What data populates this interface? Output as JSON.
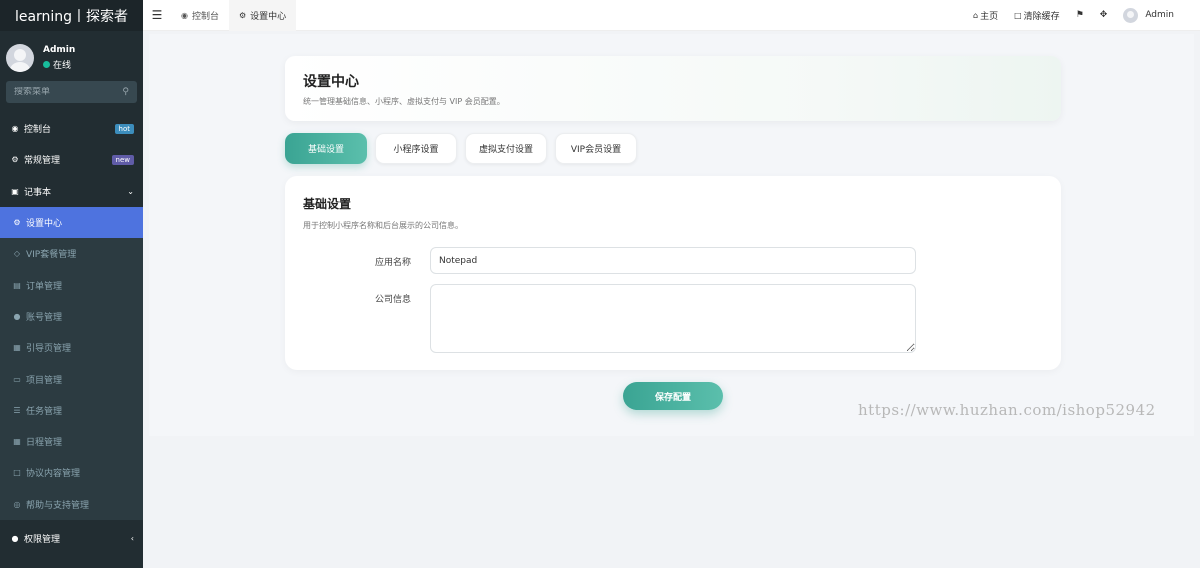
{
  "sidebar": {
    "logo": "learning丨探索者",
    "user": {
      "name": "Admin",
      "status": "在线"
    },
    "search_placeholder": "搜索菜单",
    "items": [
      {
        "label": "控制台",
        "badge": "hot",
        "icon": "dashboard-icon"
      },
      {
        "label": "常规管理",
        "badge": "new",
        "icon": "cogs-icon"
      },
      {
        "label": "记事本",
        "icon": "book-icon",
        "caret": "⌄"
      }
    ],
    "sub_items": [
      {
        "label": "设置中心",
        "active": true,
        "icon": "gear-icon"
      },
      {
        "label": "VIP套餐管理",
        "icon": "diamond-icon"
      },
      {
        "label": "订单管理",
        "icon": "list-icon"
      },
      {
        "label": "账号管理",
        "icon": "users-icon"
      },
      {
        "label": "引导页管理",
        "icon": "image-icon"
      },
      {
        "label": "项目管理",
        "icon": "folder-icon"
      },
      {
        "label": "任务管理",
        "icon": "tasks-icon"
      },
      {
        "label": "日程管理",
        "icon": "calendar-icon"
      },
      {
        "label": "协议内容管理",
        "icon": "file-icon"
      },
      {
        "label": "帮助与支持管理",
        "icon": "lifebuoy-icon"
      }
    ],
    "bottom_items": [
      {
        "label": "权限管理",
        "icon": "users-icon",
        "caret": "‹"
      }
    ]
  },
  "topbar": {
    "tabs": [
      {
        "label": "控制台",
        "icon": "dashboard-icon"
      },
      {
        "label": "设置中心",
        "icon": "gear-icon",
        "active": true
      }
    ],
    "links": {
      "home": "主页",
      "clear_cache": "清除缓存",
      "admin": "Admin"
    }
  },
  "header": {
    "title": "设置中心",
    "desc": "统一管理基础信息、小程序、虚拟支付与 VIP 会员配置。"
  },
  "tabs": [
    "基础设置",
    "小程序设置",
    "虚拟支付设置",
    "VIP会员设置"
  ],
  "form": {
    "title": "基础设置",
    "desc": "用于控制小程序名称和后台展示的公司信息。",
    "app_name_label": "应用名称",
    "app_name_value": "Notepad",
    "company_label": "公司信息",
    "company_value": ""
  },
  "save_label": "保存配置",
  "watermark": "https://www.huzhan.com/ishop52942",
  "colors": {
    "accent": "#3aa493",
    "sidebar": "#222d32",
    "active_nav": "#4e73df"
  }
}
